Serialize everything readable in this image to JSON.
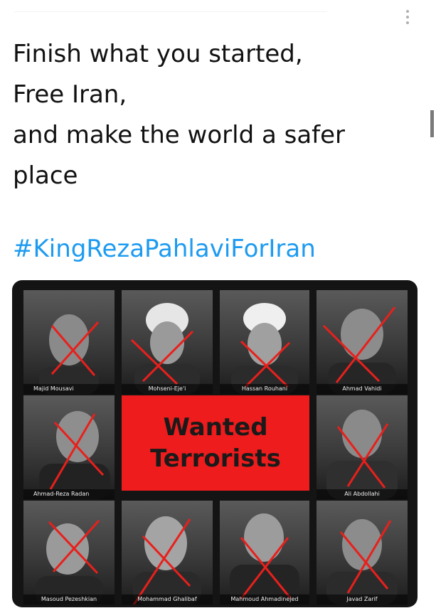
{
  "tweet": {
    "text_lines": [
      "Finish what you started,",
      "Free Iran,",
      "and make the world a safer",
      "place"
    ],
    "hashtag": "#KingRezaPahlaviForIran"
  },
  "icons": {
    "more": "more-vertical-icon"
  },
  "image": {
    "banner_line1": "Wanted",
    "banner_line2": "Terrorists",
    "banner_color": "#ee1c1c",
    "cross_color": "#e8201c",
    "people": [
      "Majid Mousavi",
      "Mohseni-Eje'i",
      "Hassan Rouhani",
      "Ahmad Vahidi",
      "Ahmad-Reza Radan",
      "Ali Abdollahi",
      "Masoud Pezeshkian",
      "Mohammad Ghalibaf",
      "Mahmoud Ahmadinejed",
      "Javad Zarif"
    ]
  },
  "colors": {
    "hashtag": "#1d9bf0",
    "text": "#111111",
    "card_bg": "#141414"
  }
}
